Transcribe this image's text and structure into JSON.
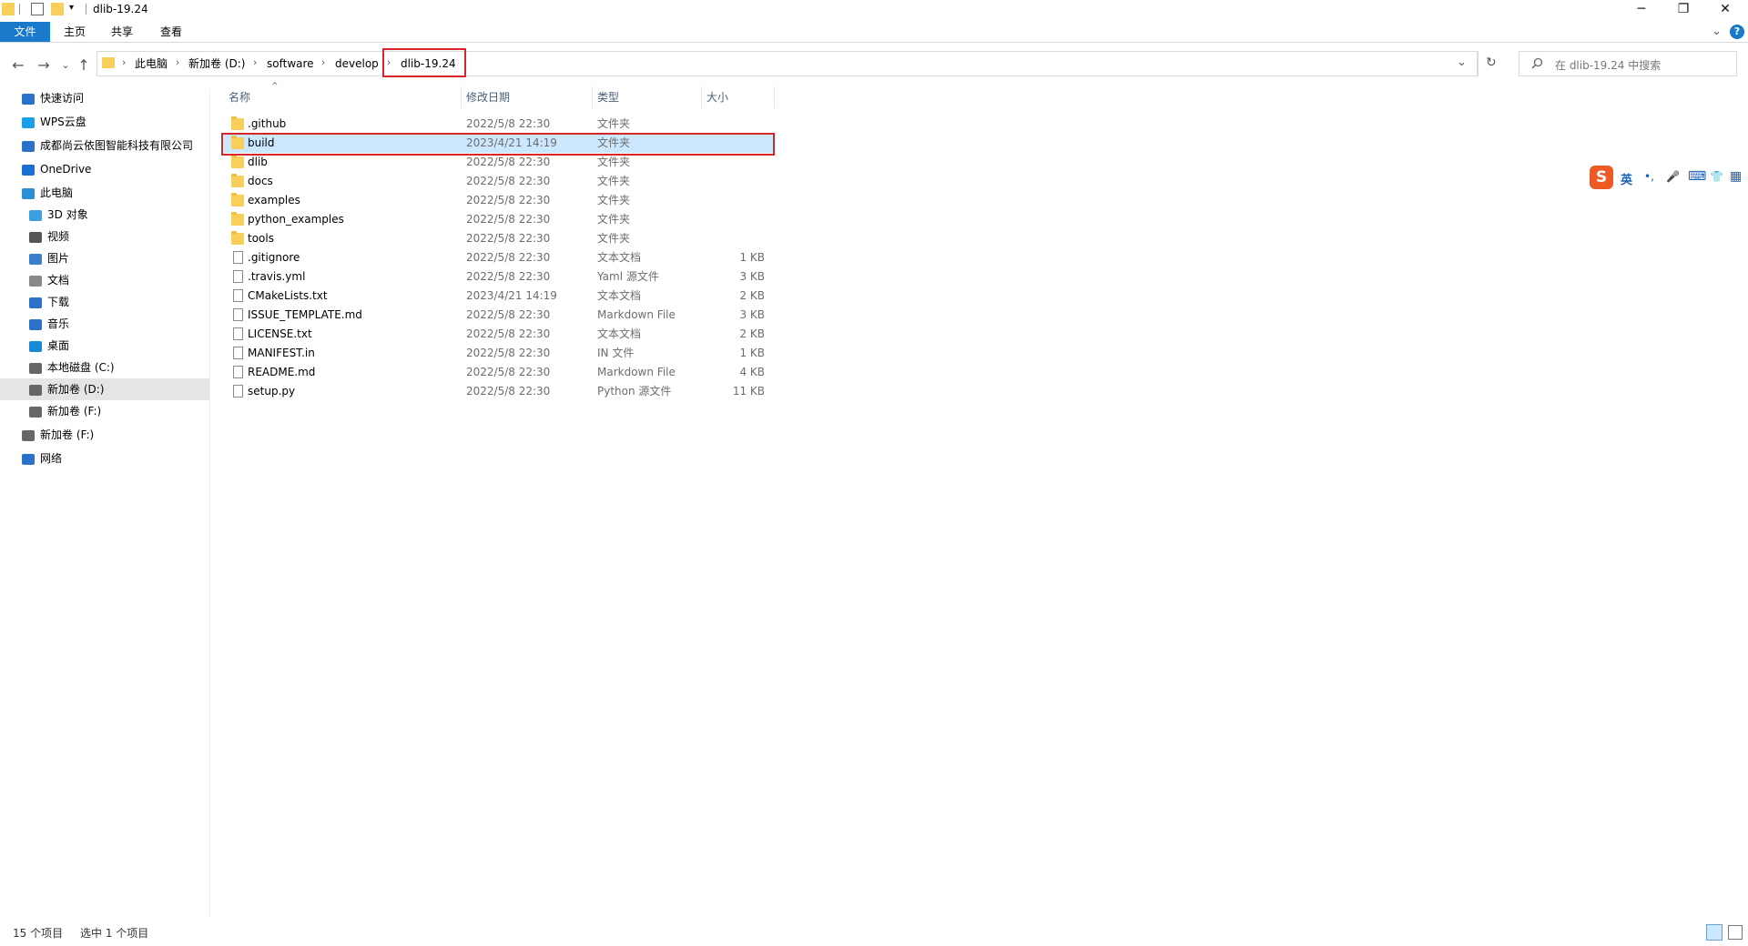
{
  "window": {
    "title": "dlib-19.24",
    "controls": {
      "minimize": "─",
      "maximize": "❐",
      "close": "✕"
    }
  },
  "ribbon": {
    "tabs": [
      "文件",
      "主页",
      "共享",
      "查看"
    ],
    "expand_icon": "⌄",
    "help_icon": "?"
  },
  "nav": {
    "back": "←",
    "forward": "→",
    "recent": "⌄",
    "up": "↑",
    "breadcrumbs": [
      "此电脑",
      "新加卷 (D:)",
      "software",
      "develop",
      "dlib-19.24"
    ],
    "separator": "›",
    "dropdown": "⌄",
    "refresh": "↻",
    "search_placeholder": "在 dlib-19.24 中搜索"
  },
  "sidebar": {
    "items": [
      {
        "label": "快速访问",
        "icon": "star-icon",
        "indent": 0
      },
      {
        "label": "WPS云盘",
        "icon": "cloud-icon",
        "indent": 0
      },
      {
        "label": "成都尚云依图智能科技有限公司",
        "icon": "building-icon",
        "indent": 0
      },
      {
        "label": "OneDrive",
        "icon": "onedrive-icon",
        "indent": 0
      },
      {
        "label": "此电脑",
        "icon": "computer-icon",
        "indent": 0
      },
      {
        "label": "3D 对象",
        "icon": "cube-icon",
        "indent": 1
      },
      {
        "label": "视频",
        "icon": "video-icon",
        "indent": 1
      },
      {
        "label": "图片",
        "icon": "picture-icon",
        "indent": 1
      },
      {
        "label": "文档",
        "icon": "document-icon",
        "indent": 1
      },
      {
        "label": "下载",
        "icon": "download-icon",
        "indent": 1
      },
      {
        "label": "音乐",
        "icon": "music-icon",
        "indent": 1
      },
      {
        "label": "桌面",
        "icon": "desktop-icon",
        "indent": 1
      },
      {
        "label": "本地磁盘 (C:)",
        "icon": "drive-icon",
        "indent": 1
      },
      {
        "label": "新加卷 (D:)",
        "icon": "drive-icon",
        "indent": 1,
        "selected": true
      },
      {
        "label": "新加卷 (F:)",
        "icon": "drive-icon",
        "indent": 1
      },
      {
        "label": "新加卷 (F:)",
        "icon": "drive-icon",
        "indent": 0
      },
      {
        "label": "网络",
        "icon": "network-icon",
        "indent": 0
      }
    ]
  },
  "columns": {
    "name": "名称",
    "date": "修改日期",
    "type": "类型",
    "size": "大小",
    "sort_indicator": "^"
  },
  "files": [
    {
      "name": ".github",
      "date": "2022/5/8 22:30",
      "type": "文件夹",
      "size": "",
      "kind": "folder"
    },
    {
      "name": "build",
      "date": "2023/4/21 14:19",
      "type": "文件夹",
      "size": "",
      "kind": "folder",
      "selected": true
    },
    {
      "name": "dlib",
      "date": "2022/5/8 22:30",
      "type": "文件夹",
      "size": "",
      "kind": "folder"
    },
    {
      "name": "docs",
      "date": "2022/5/8 22:30",
      "type": "文件夹",
      "size": "",
      "kind": "folder"
    },
    {
      "name": "examples",
      "date": "2022/5/8 22:30",
      "type": "文件夹",
      "size": "",
      "kind": "folder"
    },
    {
      "name": "python_examples",
      "date": "2022/5/8 22:30",
      "type": "文件夹",
      "size": "",
      "kind": "folder"
    },
    {
      "name": "tools",
      "date": "2022/5/8 22:30",
      "type": "文件夹",
      "size": "",
      "kind": "folder"
    },
    {
      "name": ".gitignore",
      "date": "2022/5/8 22:30",
      "type": "文本文档",
      "size": "1 KB",
      "kind": "file"
    },
    {
      "name": ".travis.yml",
      "date": "2022/5/8 22:30",
      "type": "Yaml 源文件",
      "size": "3 KB",
      "kind": "file"
    },
    {
      "name": "CMakeLists.txt",
      "date": "2023/4/21 14:19",
      "type": "文本文档",
      "size": "2 KB",
      "kind": "file"
    },
    {
      "name": "ISSUE_TEMPLATE.md",
      "date": "2022/5/8 22:30",
      "type": "Markdown File",
      "size": "3 KB",
      "kind": "file"
    },
    {
      "name": "LICENSE.txt",
      "date": "2022/5/8 22:30",
      "type": "文本文档",
      "size": "2 KB",
      "kind": "file"
    },
    {
      "name": "MANIFEST.in",
      "date": "2022/5/8 22:30",
      "type": "IN 文件",
      "size": "1 KB",
      "kind": "file"
    },
    {
      "name": "README.md",
      "date": "2022/5/8 22:30",
      "type": "Markdown File",
      "size": "4 KB",
      "kind": "file"
    },
    {
      "name": "setup.py",
      "date": "2022/5/8 22:30",
      "type": "Python 源文件",
      "size": "11 KB",
      "kind": "file"
    }
  ],
  "status": {
    "count": "15 个项目",
    "selected": "选中 1 个项目"
  },
  "ime": {
    "logo": "S",
    "lang": "英",
    "punct": "•,",
    "mic": "🎤",
    "keyboard": "⌨",
    "skin": "👕",
    "grid": "▦"
  },
  "colors": {
    "accent": "#1979ca",
    "selection": "#cce8ff",
    "highlight": "#d4262b",
    "folder": "#f7cf5a"
  }
}
